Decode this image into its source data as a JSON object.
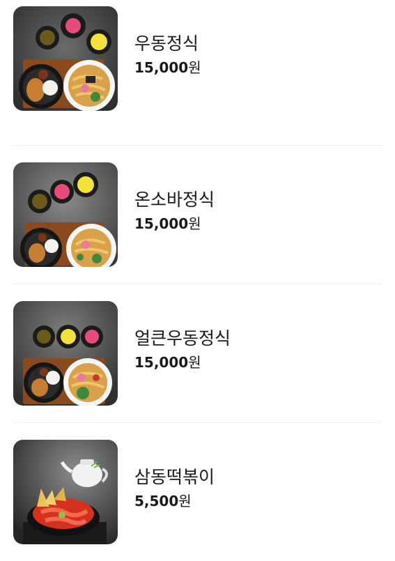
{
  "menu": {
    "items": [
      {
        "name": "우동정식",
        "price": "15,000",
        "currency": "원",
        "image": "udon-set-photo"
      },
      {
        "name": "온소바정식",
        "price": "15,000",
        "currency": "원",
        "image": "onsoba-set-photo"
      },
      {
        "name": "얼큰우동정식",
        "price": "15,000",
        "currency": "원",
        "image": "spicy-udon-set-photo"
      },
      {
        "name": "삼동떡볶이",
        "price": "5,500",
        "currency": "원",
        "image": "tteokbokki-photo"
      }
    ]
  }
}
